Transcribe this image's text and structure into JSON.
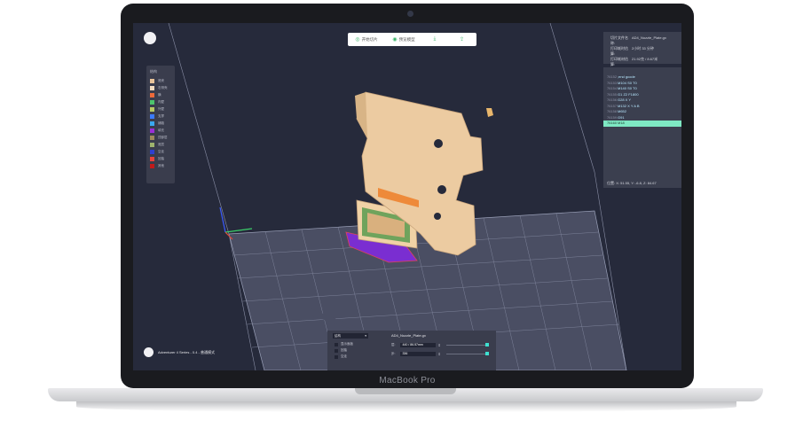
{
  "device": {
    "brand_label": "MacBook Pro"
  },
  "toolbar": {
    "items": [
      {
        "icon": "slice-icon",
        "label": "开始切片"
      },
      {
        "icon": "preview-icon",
        "label": "预览模型"
      },
      {
        "icon": "download-icon",
        "label": ""
      },
      {
        "icon": "print-icon",
        "label": ""
      }
    ]
  },
  "legend": {
    "title": "结构",
    "items": [
      {
        "label": "底壳",
        "color": "#e9c49a"
      },
      {
        "label": "右侧壳",
        "color": "#f2dcc0"
      },
      {
        "label": "横",
        "color": "#ee6a3a"
      },
      {
        "label": "内壁",
        "color": "#4cc46c"
      },
      {
        "label": "外壁",
        "color": "#b7c963"
      },
      {
        "label": "支撑",
        "color": "#3b7bff"
      },
      {
        "label": "铺路",
        "color": "#3aa8f0"
      },
      {
        "label": "填充",
        "color": "#9b2fd6"
      },
      {
        "label": "顶部层",
        "color": "#9e8a5c"
      },
      {
        "label": "底层",
        "color": "#9fb46e"
      },
      {
        "label": "空走",
        "color": "#2f3fd0"
      },
      {
        "label": "回抽",
        "color": "#e9443a"
      },
      {
        "label": "其他",
        "color": "#c11a1a"
      }
    ]
  },
  "info_panel": {
    "rows": [
      {
        "label": "切片文件名称:",
        "value": "AD4_Nozzle_Plate.gx"
      },
      {
        "label": "打印耗时估算:",
        "value": "2小时 33 分钟"
      },
      {
        "label": "打印耗材估算:",
        "value": "21.92克 / 8.67米"
      }
    ]
  },
  "gcode": {
    "lines": [
      {
        "num": "76152",
        "code": ";end gcode"
      },
      {
        "num": "76153",
        "code": "M104 S0 T0"
      },
      {
        "num": "76154",
        "code": "M140 S0 T0"
      },
      {
        "num": "76155",
        "code": "G1 Z2 F1800"
      },
      {
        "num": "76156",
        "code": "G28 X Y"
      },
      {
        "num": "76157",
        "code": "M132 X Y A B"
      },
      {
        "num": "76158",
        "code": "M652"
      },
      {
        "num": "76159",
        "code": "G91"
      },
      {
        "num": "76160",
        "code": "M18",
        "highlight": true
      }
    ],
    "position": "位置: X: 51.55, Y: -6.8, Z: 84.67"
  },
  "bottom_panel": {
    "select_value": "结构",
    "options": [
      "显示面板",
      "回抽",
      "空走"
    ],
    "file_name": "AD4_Nozzle_Plate.gx",
    "rows": [
      {
        "label": "层:",
        "value": "440 / 86.57mm"
      },
      {
        "label": "步:",
        "value": "336"
      }
    ]
  },
  "status": {
    "text": "Adventurer 4 Series - 0.4 - 普通模式"
  }
}
